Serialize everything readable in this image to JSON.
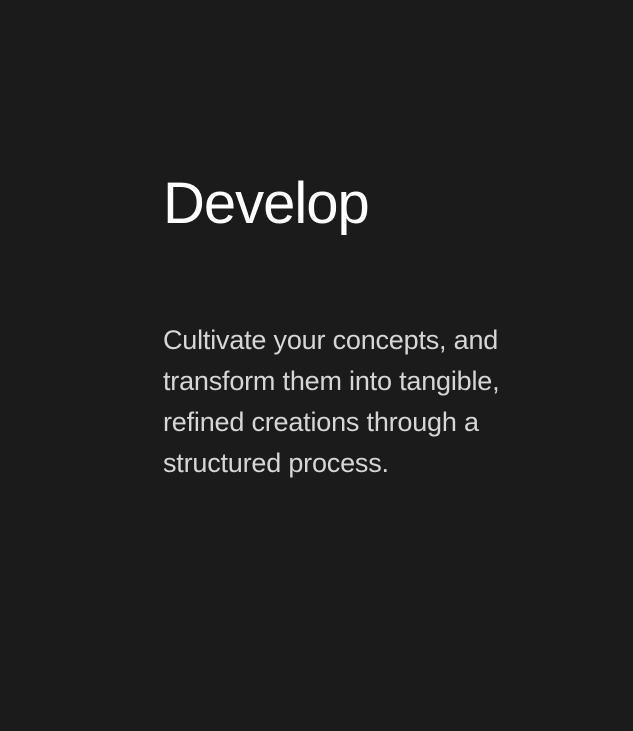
{
  "card": {
    "title": "Develop",
    "description": "Cultivate your concepts, and transform them into tangible, refined creations through a structured process."
  },
  "colors": {
    "background": "#1b1b1b",
    "title": "#ffffff",
    "text": "#d6d6d6"
  }
}
